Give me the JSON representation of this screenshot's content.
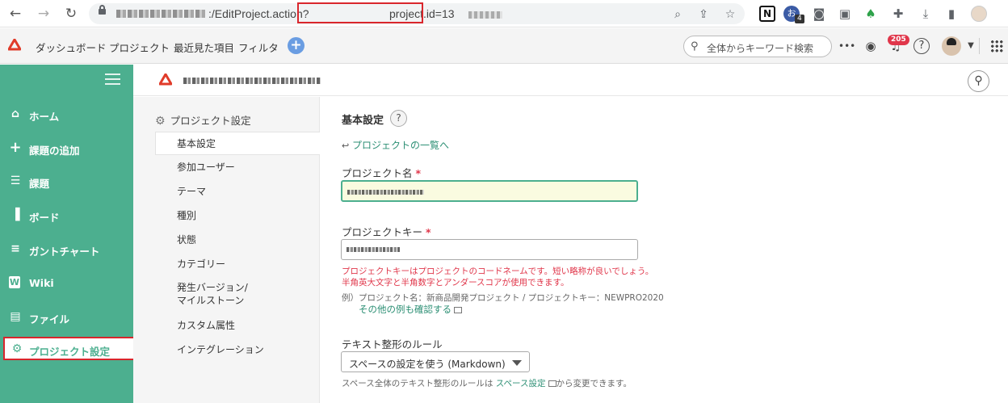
{
  "browser": {
    "url_path": ":/EditProject.action?",
    "url_param": "project.id=13",
    "icons": [
      "back-arrow",
      "forward-arrow",
      "reload",
      "lock",
      "zoom",
      "share",
      "bookmark-star",
      "notion",
      "extension-badge",
      "camera",
      "screenshot",
      "evernote",
      "puzzle",
      "download",
      "sidepanel",
      "profile"
    ],
    "ext_badge": "4"
  },
  "appbar": {
    "links": [
      "ダッシュボード",
      "プロジェクト",
      "最近見た項目",
      "フィルタ"
    ],
    "add_label": "+",
    "search_placeholder": "全体からキーワード検索",
    "more_label": "•••",
    "notification_count": "205",
    "help_label": "?"
  },
  "sidebar": {
    "items": [
      {
        "label": "ホーム",
        "icon": "home-icon",
        "glyph": "⌂"
      },
      {
        "label": "課題の追加",
        "icon": "plus-icon",
        "glyph": "+"
      },
      {
        "label": "課題",
        "icon": "list-icon",
        "glyph": "☰"
      },
      {
        "label": "ボード",
        "icon": "board-icon",
        "glyph": "▐"
      },
      {
        "label": "ガントチャート",
        "icon": "gantt-icon",
        "glyph": "≡"
      },
      {
        "label": "Wiki",
        "icon": "wiki-icon",
        "glyph": "W"
      },
      {
        "label": "ファイル",
        "icon": "file-icon",
        "glyph": "▤"
      },
      {
        "label": "プロジェクト設定",
        "icon": "gear-icon",
        "glyph": "⚙"
      }
    ]
  },
  "settings_menu": {
    "title": "プロジェクト設定",
    "items": [
      "基本設定",
      "参加ユーザー",
      "テーマ",
      "種別",
      "状態",
      "カテゴリー",
      "発生バージョン/\nマイルストーン",
      "カスタム属性",
      "インテグレーション"
    ]
  },
  "main": {
    "title": "基本設定",
    "help_label": "?",
    "back_link": "プロジェクトの一覧へ",
    "project_name_label": "プロジェクト名",
    "project_key_label": "プロジェクトキー",
    "required_mark": "*",
    "key_error_1": "プロジェクトキーはプロジェクトのコードネームです。短い略称が良いでしょう。",
    "key_error_2": "半角英大文字と半角数字とアンダースコアが使用できます。",
    "example": "例）プロジェクト名：新商品開発プロジェクト / プロジェクトキー：NEWPRO2020",
    "other_examples_link": "その他の例も確認する",
    "text_rule_label": "テキスト整形のルール",
    "text_rule_value": "スペースの設定を使う (Markdown)",
    "note_prefix": "スペース全体のテキスト整形のルールは",
    "note_link": "スペース設定",
    "note_suffix": "から変更できます。"
  },
  "colors": {
    "brand_green": "#4caf8f",
    "link_green": "#2c8f74",
    "error_red": "#e0364a",
    "highlight_red": "#d9262c"
  }
}
